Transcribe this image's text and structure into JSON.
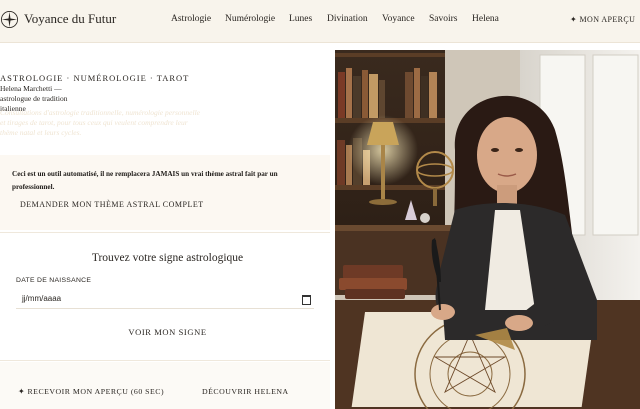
{
  "header": {
    "brand": "Voyance du Futur",
    "logo_icon": "compass-star-icon",
    "nav": [
      "Astrologie",
      "Numérologie",
      "Lunes",
      "Divination",
      "Voyance",
      "Savoirs",
      "Helena"
    ],
    "cta_label": "✦  MON APERÇU"
  },
  "intro": {
    "kicker": "ASTROLOGIE · NUMÉROLOGIE · TAROT",
    "author": "Helena Marchetti — astrologue de tradition italienne",
    "faded_text": "Consultations d'astrologie traditionnelle, numérologie personnelle et tirages de tarot, pour tous ceux qui veulent comprendre leur thème natal et leurs cycles."
  },
  "warning": {
    "text": "Ceci est un outil automatisé, il ne remplacera JAMAIS un vrai thème astral fait par un professionnel.",
    "button": "DEMANDER MON THÈME ASTRAL COMPLET"
  },
  "sign_finder": {
    "title": "Trouvez votre signe astrologique",
    "dob_label": "DATE DE NAISSANCE",
    "dob_placeholder": "jj/mm/aaaa",
    "submit": "VOIR MON SIGNE"
  },
  "footer_actions": {
    "apercu": "✦  RECEVOIR MON APERÇU (60 SEC)",
    "helena": "DÉCOUVRIR HELENA"
  },
  "colors": {
    "header_bg": "#f8f4ec",
    "accent_gold": "#c9a86a",
    "text": "#2a2622"
  }
}
